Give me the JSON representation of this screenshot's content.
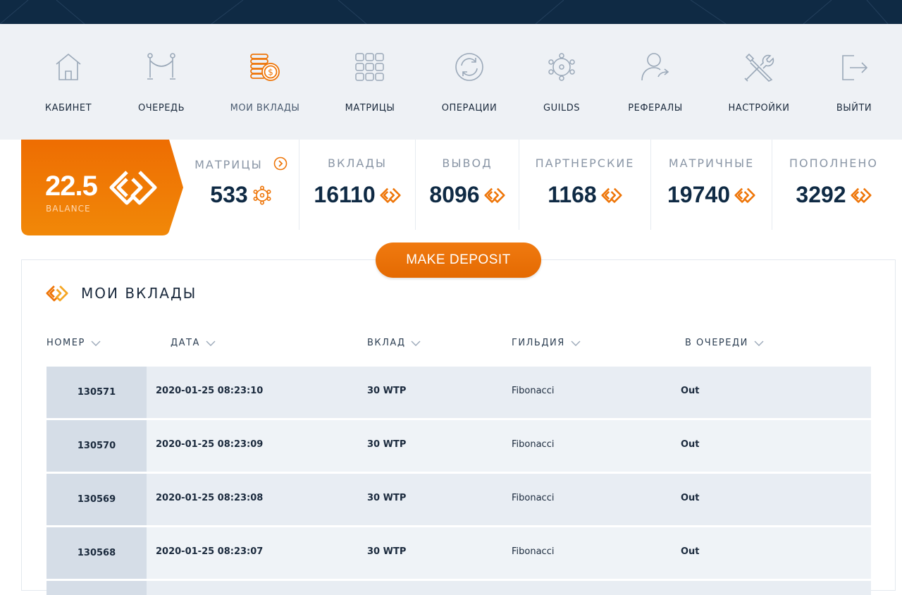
{
  "nav": [
    {
      "id": "cabinet",
      "label": "КАБИНЕТ",
      "icon": "house-icon"
    },
    {
      "id": "queue",
      "label": "ОЧЕРЕДЬ",
      "icon": "queue-barrier-icon"
    },
    {
      "id": "deposits",
      "label": "МОИ ВКЛАДЫ",
      "icon": "coins-icon",
      "active": true
    },
    {
      "id": "matrices",
      "label": "МАТРИЦЫ",
      "icon": "grid-icon"
    },
    {
      "id": "operations",
      "label": "ОПЕРАЦИИ",
      "icon": "refresh-icon"
    },
    {
      "id": "guilds",
      "label": "GUILDS",
      "icon": "network-icon"
    },
    {
      "id": "referrals",
      "label": "РЕФЕРАЛЫ",
      "icon": "user-share-icon"
    },
    {
      "id": "settings",
      "label": "НАСТРОЙКИ",
      "icon": "tools-icon"
    },
    {
      "id": "logout",
      "label": "ВЫЙТИ",
      "icon": "logout-icon"
    }
  ],
  "balance": {
    "value": "22.5",
    "caption": "BALANCE"
  },
  "stats": [
    {
      "title": "МАТРИЦЫ",
      "value": "533",
      "icon": "matrix-node-icon"
    },
    {
      "title": "ВКЛАДЫ",
      "value": "16110",
      "icon": "diamond-logo-icon"
    },
    {
      "title": "ВЫВОД",
      "value": "8096",
      "icon": "diamond-logo-icon"
    },
    {
      "title": "ПАРТНЕРСКИЕ",
      "value": "1168",
      "icon": "diamond-logo-icon"
    },
    {
      "title": "МАТРИЧНЫЕ",
      "value": "19740",
      "icon": "diamond-logo-icon"
    },
    {
      "title": "ПОПОЛНЕНО",
      "value": "3292",
      "icon": "diamond-logo-icon"
    }
  ],
  "deposit_button": "MAKE DEPOSIT",
  "panel": {
    "title": "МОИ ВКЛАДЫ"
  },
  "table": {
    "columns": [
      "НОМЕР",
      "ДАТА",
      "ВКЛАД",
      "ГИЛЬДИЯ",
      "В ОЧЕРЕДИ"
    ],
    "rows": [
      {
        "number": "130571",
        "date": "2020-01-25 08:23:10",
        "deposit": "30 WTP",
        "guild": "Fibonacci",
        "queue": "Out"
      },
      {
        "number": "130570",
        "date": "2020-01-25 08:23:09",
        "deposit": "30 WTP",
        "guild": "Fibonacci",
        "queue": "Out"
      },
      {
        "number": "130569",
        "date": "2020-01-25 08:23:08",
        "deposit": "30 WTP",
        "guild": "Fibonacci",
        "queue": "Out"
      },
      {
        "number": "130568",
        "date": "2020-01-25 08:23:07",
        "deposit": "30 WTP",
        "guild": "Fibonacci",
        "queue": "Out"
      }
    ]
  },
  "colors": {
    "accent": "#ee7508",
    "navy": "#0f2a44",
    "row": "#e8edf3",
    "row_number": "#d5dde7"
  }
}
